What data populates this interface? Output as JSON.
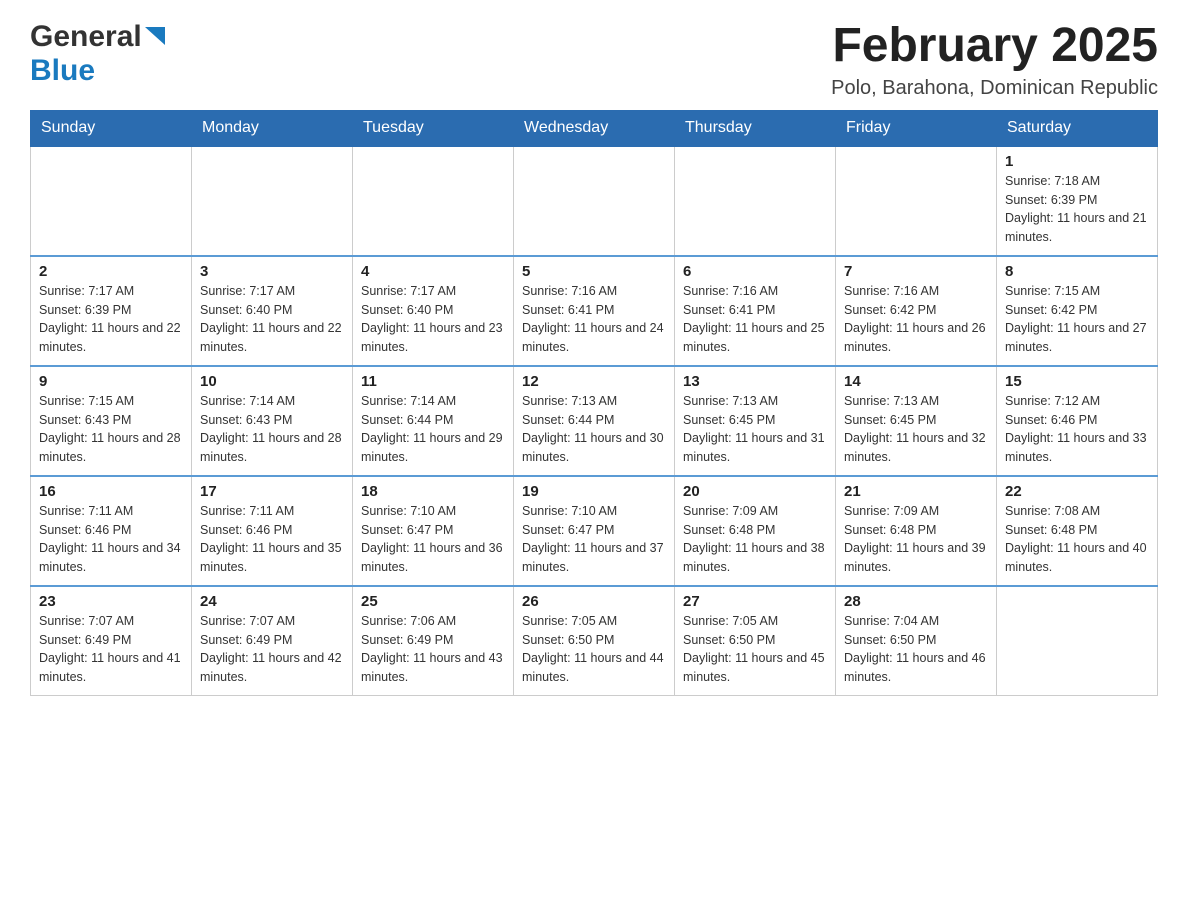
{
  "header": {
    "logo": {
      "general": "General",
      "blue": "Blue"
    },
    "title": "February 2025",
    "location": "Polo, Barahona, Dominican Republic"
  },
  "days_of_week": [
    "Sunday",
    "Monday",
    "Tuesday",
    "Wednesday",
    "Thursday",
    "Friday",
    "Saturday"
  ],
  "weeks": [
    [
      {
        "day": "",
        "info": ""
      },
      {
        "day": "",
        "info": ""
      },
      {
        "day": "",
        "info": ""
      },
      {
        "day": "",
        "info": ""
      },
      {
        "day": "",
        "info": ""
      },
      {
        "day": "",
        "info": ""
      },
      {
        "day": "1",
        "info": "Sunrise: 7:18 AM\nSunset: 6:39 PM\nDaylight: 11 hours and 21 minutes."
      }
    ],
    [
      {
        "day": "2",
        "info": "Sunrise: 7:17 AM\nSunset: 6:39 PM\nDaylight: 11 hours and 22 minutes."
      },
      {
        "day": "3",
        "info": "Sunrise: 7:17 AM\nSunset: 6:40 PM\nDaylight: 11 hours and 22 minutes."
      },
      {
        "day": "4",
        "info": "Sunrise: 7:17 AM\nSunset: 6:40 PM\nDaylight: 11 hours and 23 minutes."
      },
      {
        "day": "5",
        "info": "Sunrise: 7:16 AM\nSunset: 6:41 PM\nDaylight: 11 hours and 24 minutes."
      },
      {
        "day": "6",
        "info": "Sunrise: 7:16 AM\nSunset: 6:41 PM\nDaylight: 11 hours and 25 minutes."
      },
      {
        "day": "7",
        "info": "Sunrise: 7:16 AM\nSunset: 6:42 PM\nDaylight: 11 hours and 26 minutes."
      },
      {
        "day": "8",
        "info": "Sunrise: 7:15 AM\nSunset: 6:42 PM\nDaylight: 11 hours and 27 minutes."
      }
    ],
    [
      {
        "day": "9",
        "info": "Sunrise: 7:15 AM\nSunset: 6:43 PM\nDaylight: 11 hours and 28 minutes."
      },
      {
        "day": "10",
        "info": "Sunrise: 7:14 AM\nSunset: 6:43 PM\nDaylight: 11 hours and 28 minutes."
      },
      {
        "day": "11",
        "info": "Sunrise: 7:14 AM\nSunset: 6:44 PM\nDaylight: 11 hours and 29 minutes."
      },
      {
        "day": "12",
        "info": "Sunrise: 7:13 AM\nSunset: 6:44 PM\nDaylight: 11 hours and 30 minutes."
      },
      {
        "day": "13",
        "info": "Sunrise: 7:13 AM\nSunset: 6:45 PM\nDaylight: 11 hours and 31 minutes."
      },
      {
        "day": "14",
        "info": "Sunrise: 7:13 AM\nSunset: 6:45 PM\nDaylight: 11 hours and 32 minutes."
      },
      {
        "day": "15",
        "info": "Sunrise: 7:12 AM\nSunset: 6:46 PM\nDaylight: 11 hours and 33 minutes."
      }
    ],
    [
      {
        "day": "16",
        "info": "Sunrise: 7:11 AM\nSunset: 6:46 PM\nDaylight: 11 hours and 34 minutes."
      },
      {
        "day": "17",
        "info": "Sunrise: 7:11 AM\nSunset: 6:46 PM\nDaylight: 11 hours and 35 minutes."
      },
      {
        "day": "18",
        "info": "Sunrise: 7:10 AM\nSunset: 6:47 PM\nDaylight: 11 hours and 36 minutes."
      },
      {
        "day": "19",
        "info": "Sunrise: 7:10 AM\nSunset: 6:47 PM\nDaylight: 11 hours and 37 minutes."
      },
      {
        "day": "20",
        "info": "Sunrise: 7:09 AM\nSunset: 6:48 PM\nDaylight: 11 hours and 38 minutes."
      },
      {
        "day": "21",
        "info": "Sunrise: 7:09 AM\nSunset: 6:48 PM\nDaylight: 11 hours and 39 minutes."
      },
      {
        "day": "22",
        "info": "Sunrise: 7:08 AM\nSunset: 6:48 PM\nDaylight: 11 hours and 40 minutes."
      }
    ],
    [
      {
        "day": "23",
        "info": "Sunrise: 7:07 AM\nSunset: 6:49 PM\nDaylight: 11 hours and 41 minutes."
      },
      {
        "day": "24",
        "info": "Sunrise: 7:07 AM\nSunset: 6:49 PM\nDaylight: 11 hours and 42 minutes."
      },
      {
        "day": "25",
        "info": "Sunrise: 7:06 AM\nSunset: 6:49 PM\nDaylight: 11 hours and 43 minutes."
      },
      {
        "day": "26",
        "info": "Sunrise: 7:05 AM\nSunset: 6:50 PM\nDaylight: 11 hours and 44 minutes."
      },
      {
        "day": "27",
        "info": "Sunrise: 7:05 AM\nSunset: 6:50 PM\nDaylight: 11 hours and 45 minutes."
      },
      {
        "day": "28",
        "info": "Sunrise: 7:04 AM\nSunset: 6:50 PM\nDaylight: 11 hours and 46 minutes."
      },
      {
        "day": "",
        "info": ""
      }
    ]
  ]
}
